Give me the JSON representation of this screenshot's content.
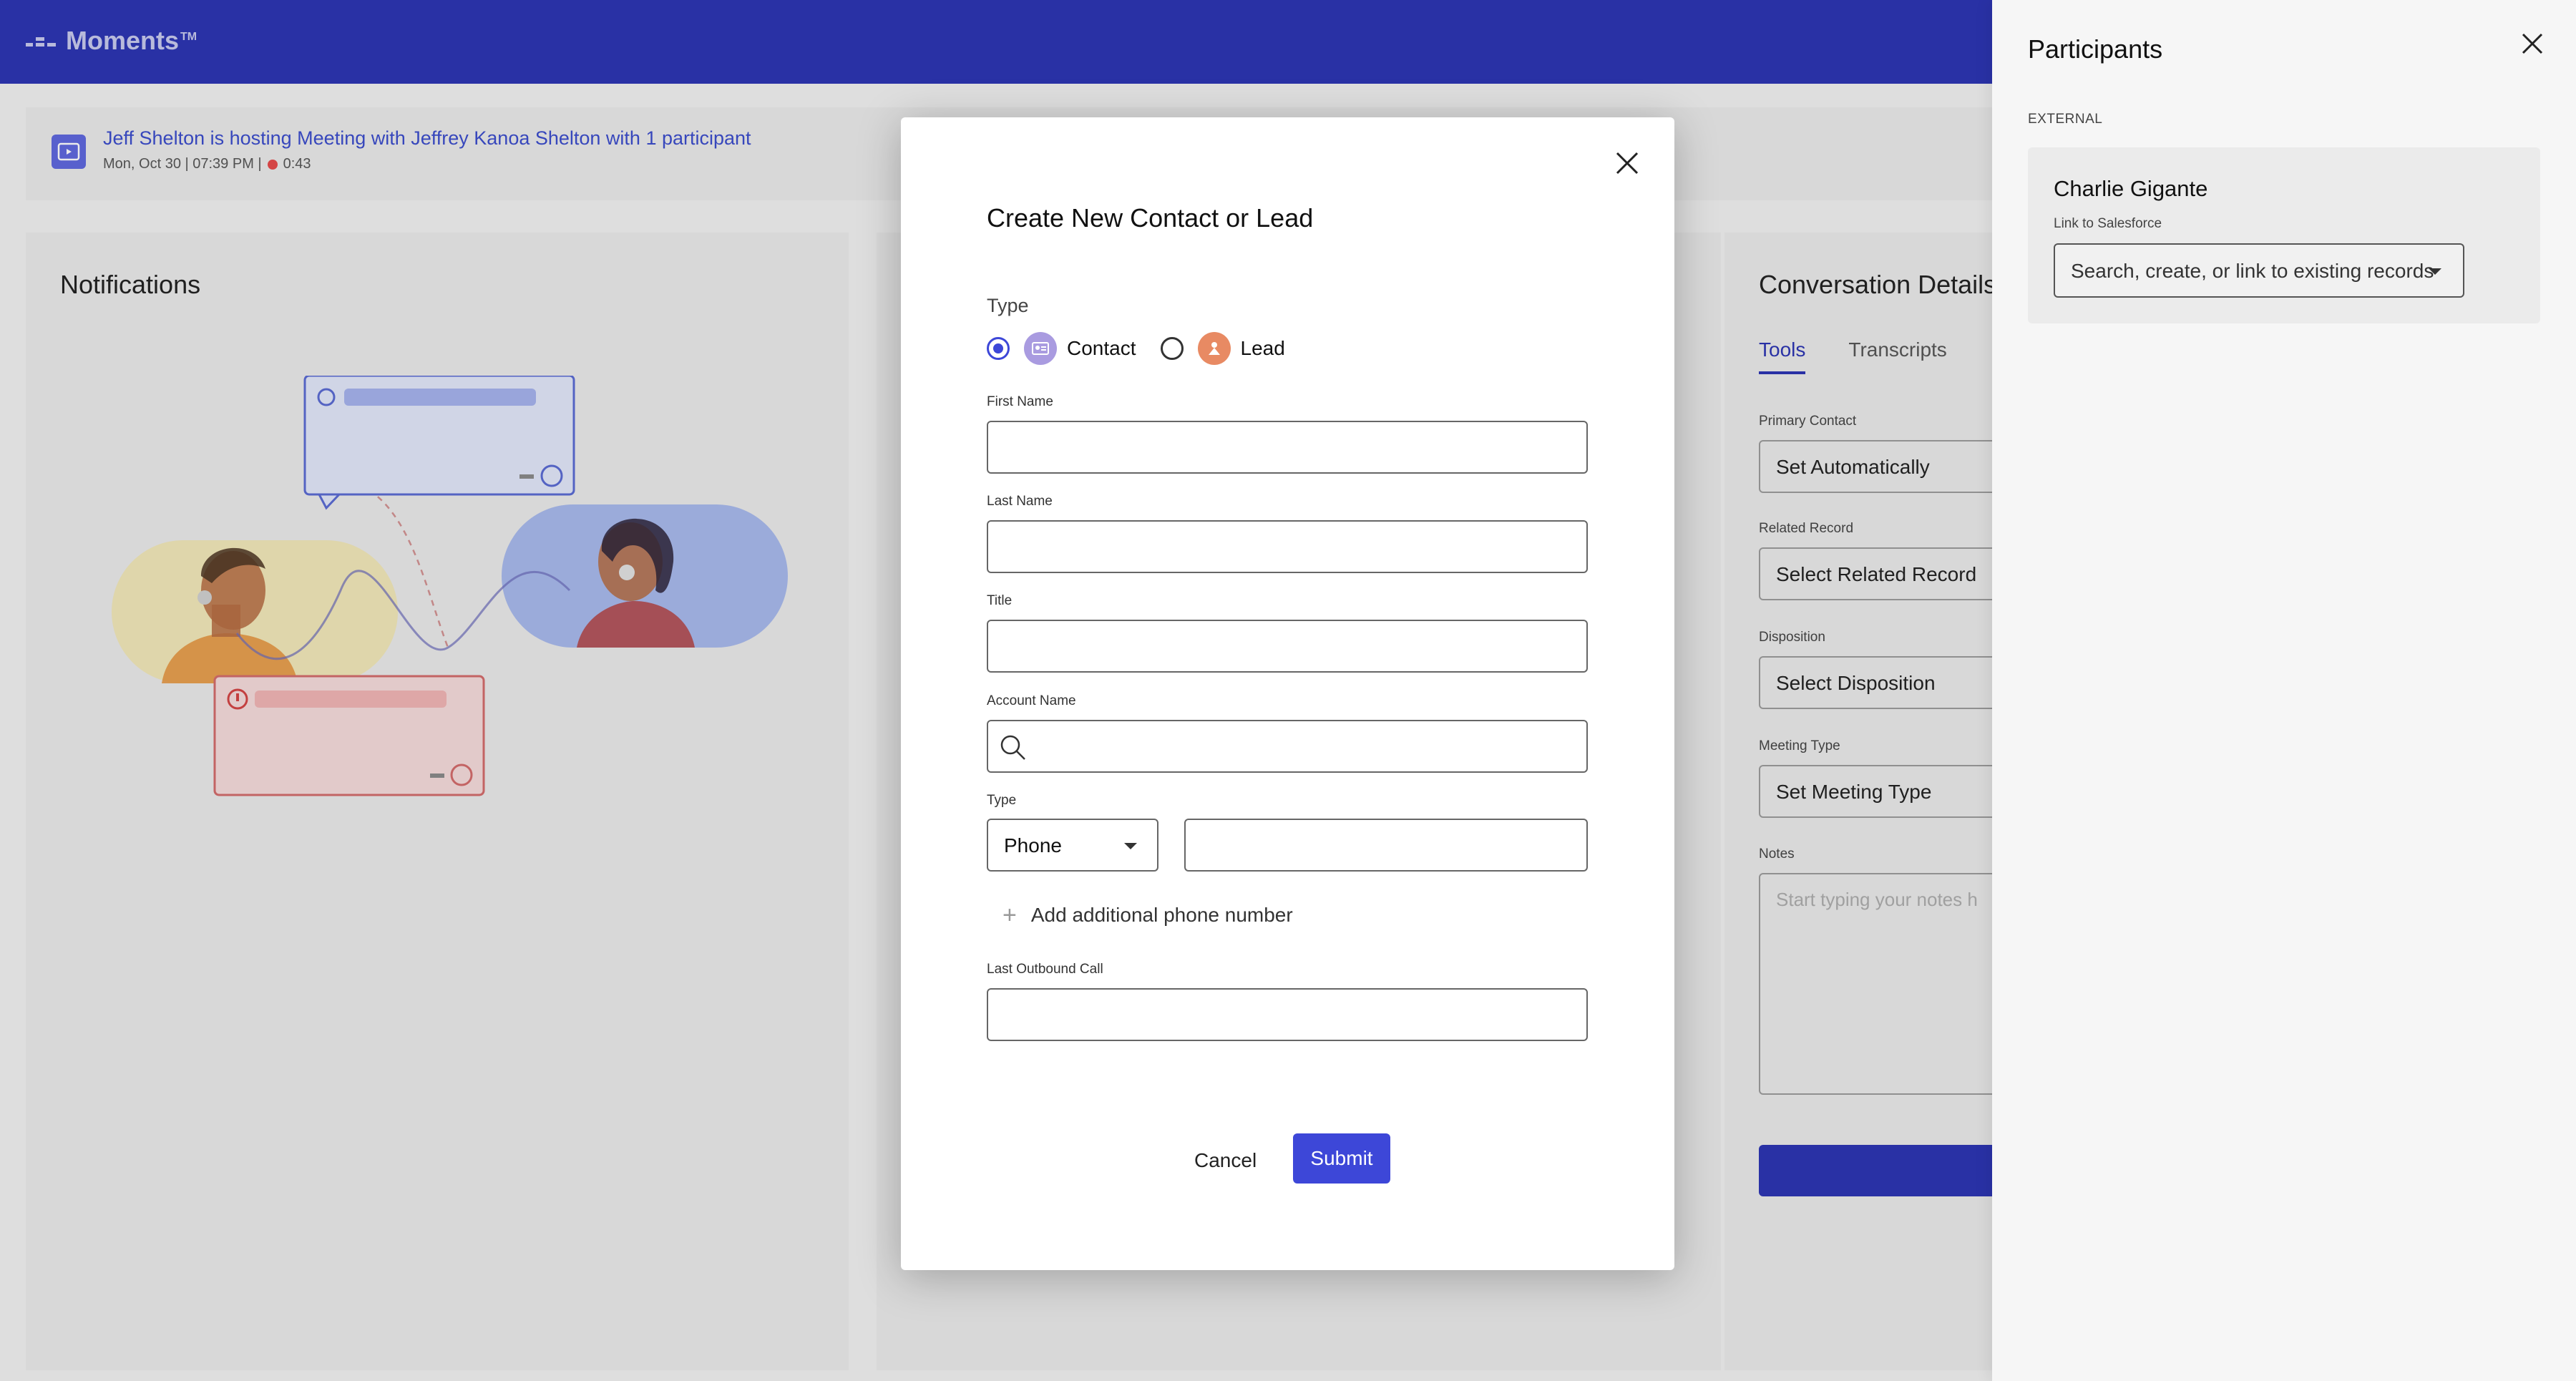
{
  "app": {
    "logo_text": "Moments",
    "logo_tm": "TM"
  },
  "meeting": {
    "title": "Jeff Shelton is hosting Meeting with Jeffrey Kanoa Shelton with 1 participant",
    "meta": "Mon, Oct 30 | 07:39 PM |",
    "duration": "0:43"
  },
  "notifications": {
    "title": "Notifications"
  },
  "conversation": {
    "title": "Conversation Details",
    "tabs": [
      {
        "label": "Tools",
        "active": true
      },
      {
        "label": "Transcripts",
        "active": false
      }
    ],
    "fields": {
      "primary_contact": {
        "label": "Primary Contact",
        "value": "Set Automatically"
      },
      "related_record": {
        "label": "Related Record",
        "value": "Select Related Record"
      },
      "disposition": {
        "label": "Disposition",
        "value": "Select Disposition"
      },
      "meeting_type": {
        "label": "Meeting Type",
        "value": "Set Meeting Type"
      },
      "notes": {
        "label": "Notes",
        "placeholder": "Start typing your notes h"
      }
    }
  },
  "modal": {
    "title": "Create New Contact or Lead",
    "type_label": "Type",
    "type_options": [
      {
        "label": "Contact",
        "checked": true,
        "icon": "contact-card-icon"
      },
      {
        "label": "Lead",
        "checked": false,
        "icon": "lead-person-icon"
      }
    ],
    "fields": {
      "first_name": {
        "label": "First Name",
        "value": ""
      },
      "last_name": {
        "label": "Last Name",
        "value": ""
      },
      "title": {
        "label": "Title",
        "value": ""
      },
      "account_name": {
        "label": "Account Name",
        "value": ""
      },
      "phone_type": {
        "label": "Type",
        "value": "Phone"
      },
      "phone_number": {
        "value": ""
      },
      "last_outbound_call": {
        "label": "Last Outbound Call",
        "value": ""
      }
    },
    "add_phone_label": "Add additional phone number",
    "cancel_label": "Cancel",
    "submit_label": "Submit"
  },
  "participants": {
    "title": "Participants",
    "section_label": "EXTERNAL",
    "items": [
      {
        "name": "Charlie Gigante",
        "link_label": "Link to Salesforce",
        "select_placeholder": "Search, create, or link to existing records"
      }
    ]
  },
  "colors": {
    "brand": "#2c35b0",
    "accent": "#3d47d8",
    "recording": "#e24a4a"
  }
}
